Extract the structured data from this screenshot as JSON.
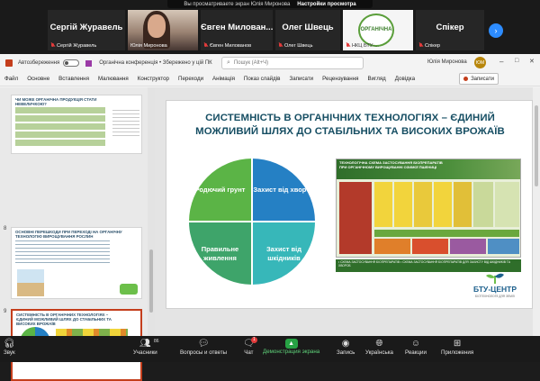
{
  "zoom_top": {
    "share_banner": {
      "text": "Вы просматриваете экран Юлія Миронова",
      "options": "Настройки просмотра"
    },
    "participants": [
      {
        "big": "Сергій Журавель",
        "small": "Сергій Журавель"
      },
      {
        "big": "",
        "small": "Юлія Миронова"
      },
      {
        "big": "Євген Милован...",
        "small": "Євген Милованов"
      },
      {
        "big": "Олег Швець",
        "small": "Олег Швець"
      },
      {
        "big": "",
        "small": "НКЦ БТУ-..."
      },
      {
        "big": "Спікер",
        "small": "Спікер"
      }
    ],
    "logo_text": "ОРГАНІЧНА"
  },
  "ppt": {
    "autosave_label": "Автозбереження",
    "doc_title": "Органічна конференція • Збережено у цій ПК",
    "search_placeholder": "Пошук (Alt+Ч)",
    "user_name": "Юлія Миронова",
    "user_initials": "ЮМ",
    "menu": [
      "Файл",
      "Основне",
      "Вставлення",
      "Малювання",
      "Конструктор",
      "Переходи",
      "Анімація",
      "Показ слайдів",
      "Записати",
      "Рецензування",
      "Вигляд",
      "Довідка"
    ],
    "notes_button": "Записати",
    "thumbnails": [
      {
        "number": "",
        "title": "ЧИ МОЖЕ ОРГАНІЧНА ПРОДУКЦІЯ СТАТИ НЕВЕЛИЧКОЮ?"
      },
      {
        "number": "8",
        "title": "ОСНОВНІ ПЕРЕШКОДИ ПРИ ПЕРЕХОДІ НА ОРГАНІЧНУ ТЕХНОЛОГІЮ ВИРОЩУВАННЯ РОСЛИН"
      },
      {
        "number": "9",
        "title": "СИСТЕМНІСТЬ В ОРГАНІЧНИХ ТЕХНОЛОГІЯХ – ЄДИНИЙ МОЖЛИВИЙ ШЛЯХ ДО СТАБІЛЬНИХ ТА ВИСОКИХ ВРОЖАЇВ"
      }
    ]
  },
  "slide": {
    "title": "СИСТЕМНІСТЬ В ОРГАНІЧНИХ ТЕХНОЛОГІЯХ – ЄДИНИЙ МОЖЛИВИЙ ШЛЯХ ДО СТАБІЛЬНИХ ТА ВИСОКИХ ВРОЖАЇВ",
    "quadrants": [
      {
        "label": "Родючий грунт",
        "color": "#5bb446"
      },
      {
        "label": "Захист від хвороб",
        "color": "#2580c4"
      },
      {
        "label": "Правильне живлення",
        "color": "#3ea46a"
      },
      {
        "label": "Захист від шкідників",
        "color": "#37b7b9"
      }
    ],
    "scheme_title": "ТЕХНОЛОГІЧНА СХЕМА ЗАСТОСУВАННЯ БІОПРЕПАРАТІВ ПРИ ОРГАНІЧНОМУ ВИРОЩУВАННІ ОЗИМОЇ ПШЕНИЦІ",
    "scheme_footer": "• СХЕМА ЗАСТОСУВАННЯ БІОПРЕПАРАТІВ • СХЕМА ЗАСТОСУВАННЯ БІОПРЕПАРАТІВ ДЛЯ ЗАХИСТУ ВІД ШКІДНИКІВ ТА ХВОРОБ",
    "logo_name": "БТУ-ЦЕНТР",
    "logo_sub": "БІОТЕХНОЛОГІЇ ДЛЯ ЗЕМЛІ"
  },
  "zoom_bottom": {
    "buttons": [
      {
        "label": "Звук",
        "icon": "headphones-icon"
      },
      {
        "label": "Учасники",
        "icon": "participants-icon",
        "badge": "86"
      },
      {
        "label": "Вопросы и ответы",
        "icon": "qa-icon"
      },
      {
        "label": "Чат",
        "icon": "chat-icon",
        "badge": "1"
      },
      {
        "label": "Демонстрация экрана",
        "icon": "share-screen-icon"
      },
      {
        "label": "Запись",
        "icon": "record-icon"
      },
      {
        "label": "Українська",
        "icon": "globe-icon"
      },
      {
        "label": "Реакции",
        "icon": "reactions-icon"
      },
      {
        "label": "Приложения",
        "icon": "apps-icon"
      }
    ]
  }
}
